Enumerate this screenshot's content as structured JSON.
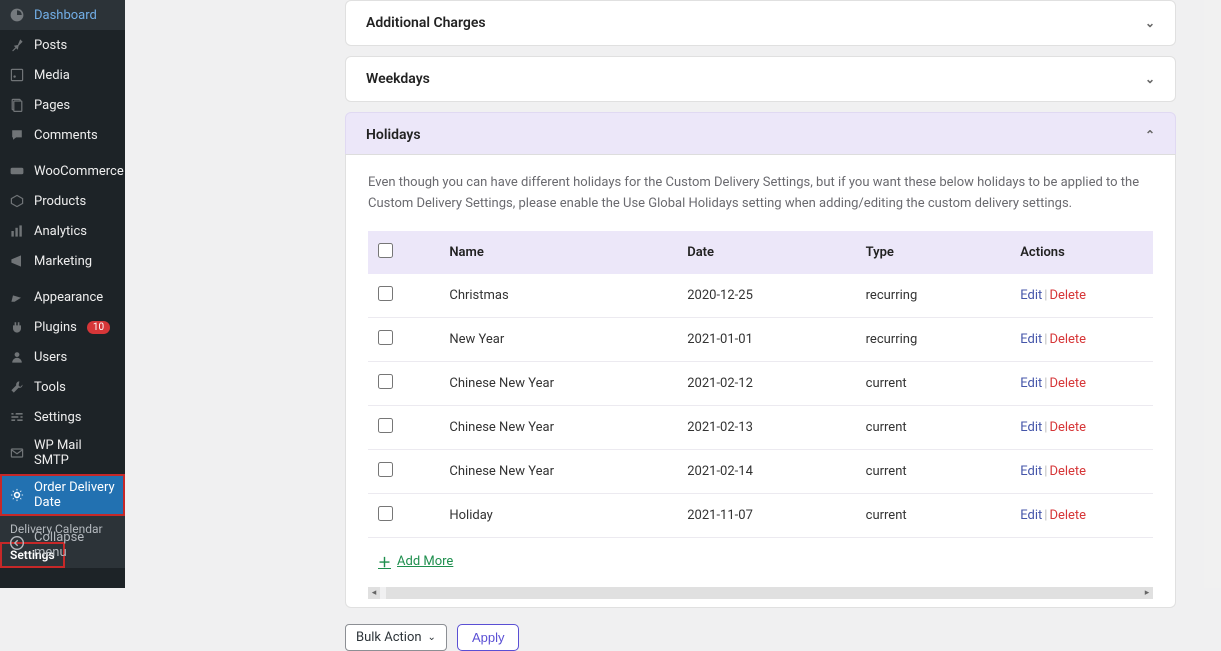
{
  "sidebar": {
    "items": [
      {
        "label": "Dashboard",
        "icon": "dashboard"
      },
      {
        "label": "Posts",
        "icon": "pin"
      },
      {
        "label": "Media",
        "icon": "media"
      },
      {
        "label": "Pages",
        "icon": "pages"
      },
      {
        "label": "Comments",
        "icon": "comments"
      },
      {
        "label": "WooCommerce",
        "icon": "woocommerce"
      },
      {
        "label": "Products",
        "icon": "products"
      },
      {
        "label": "Analytics",
        "icon": "analytics"
      },
      {
        "label": "Marketing",
        "icon": "marketing"
      },
      {
        "label": "Appearance",
        "icon": "appearance"
      },
      {
        "label": "Plugins",
        "icon": "plugins",
        "badge": "10"
      },
      {
        "label": "Users",
        "icon": "users"
      },
      {
        "label": "Tools",
        "icon": "tools"
      },
      {
        "label": "Settings",
        "icon": "settings"
      },
      {
        "label": "WP Mail SMTP",
        "icon": "mail"
      },
      {
        "label": "Order Delivery Date",
        "icon": "gear",
        "active": true,
        "highlighted": true
      }
    ],
    "submenu": [
      {
        "label": "Delivery Calendar"
      },
      {
        "label": "Settings",
        "active": true,
        "highlighted": true
      }
    ],
    "collapse": "Collapse menu"
  },
  "panels": {
    "additional_charges": "Additional Charges",
    "weekdays": "Weekdays",
    "holidays": "Holidays"
  },
  "help_text": "Even though you can have different holidays for the Custom Delivery Settings, but if you want these below holidays to be applied to the Custom Delivery Settings, please enable the Use Global Holidays setting when adding/editing the custom delivery settings.",
  "table": {
    "headers": {
      "name": "Name",
      "date": "Date",
      "type": "Type",
      "actions": "Actions"
    },
    "rows": [
      {
        "name": "Christmas",
        "date": "2020-12-25",
        "type": "recurring"
      },
      {
        "name": "New Year",
        "date": "2021-01-01",
        "type": "recurring"
      },
      {
        "name": "Chinese New Year",
        "date": "2021-02-12",
        "type": "current"
      },
      {
        "name": "Chinese New Year",
        "date": "2021-02-13",
        "type": "current"
      },
      {
        "name": "Chinese New Year",
        "date": "2021-02-14",
        "type": "current"
      },
      {
        "name": "Holiday",
        "date": "2021-11-07",
        "type": "current"
      }
    ],
    "edit_label": "Edit",
    "delete_label": "Delete"
  },
  "add_more": "Add More",
  "bulk": {
    "select": "Bulk Action",
    "apply": "Apply"
  }
}
